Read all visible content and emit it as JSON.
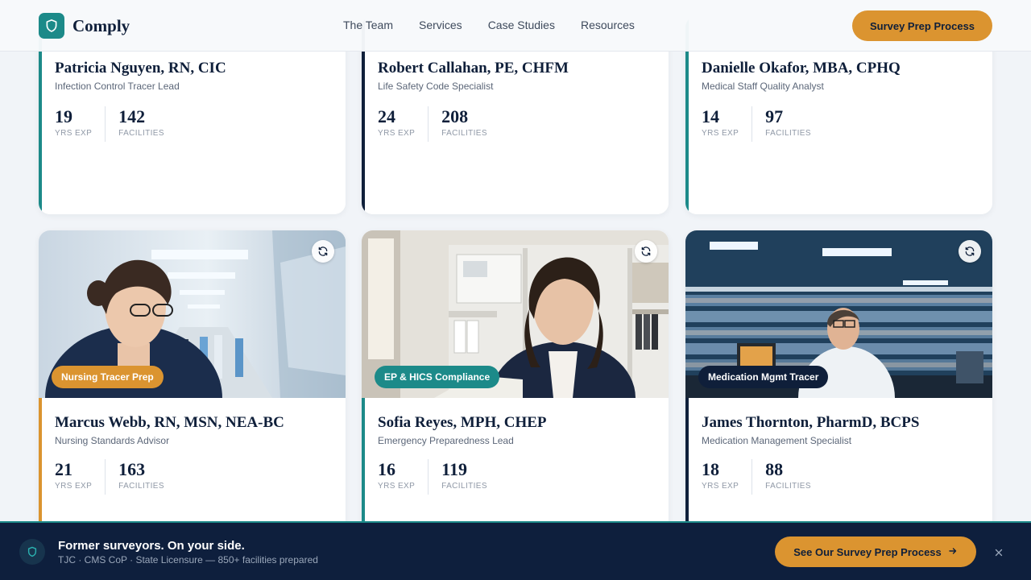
{
  "brand": {
    "name": "Comply",
    "accent": "#1c8a89",
    "navy": "#0f1f3a",
    "gold": "#db9430"
  },
  "nav": {
    "items": [
      {
        "label": "The Team"
      },
      {
        "label": "Services"
      },
      {
        "label": "Case Studies"
      },
      {
        "label": "Resources"
      }
    ],
    "cta_label": "Survey Prep Process"
  },
  "cards": [
    {
      "name": "Patricia Nguyen, RN, CIC",
      "role": "Infection Control Tracer Lead",
      "years": "19",
      "years_label": "YRS EXP",
      "facilities": "142",
      "facilities_label": "FACILITIES",
      "accent_color": "#1c8a89"
    },
    {
      "name": "Robert Callahan, PE, CHFM",
      "role": "Life Safety Code Specialist",
      "years": "24",
      "years_label": "YRS EXP",
      "facilities": "208",
      "facilities_label": "FACILITIES",
      "accent_color": "#0f1f3a"
    },
    {
      "name": "Danielle Okafor, MBA, CPHQ",
      "role": "Medical Staff Quality Analyst",
      "years": "14",
      "years_label": "YRS EXP",
      "facilities": "97",
      "facilities_label": "FACILITIES",
      "accent_color": "#1c8a89"
    },
    {
      "name": "Marcus Webb, RN, MSN, NEA-BC",
      "role": "Nursing Standards Advisor",
      "years": "21",
      "years_label": "YRS EXP",
      "facilities": "163",
      "facilities_label": "FACILITIES",
      "tag": "Nursing Tracer Prep",
      "accent_color": "#db9430"
    },
    {
      "name": "Sofia Reyes, MPH, CHEP",
      "role": "Emergency Preparedness Lead",
      "years": "16",
      "years_label": "YRS EXP",
      "facilities": "119",
      "facilities_label": "FACILITIES",
      "tag": "EP & HICS Compliance",
      "accent_color": "#1c8a89"
    },
    {
      "name": "James Thornton, PharmD, BCPS",
      "role": "Medication Management Specialist",
      "years": "18",
      "years_label": "YRS EXP",
      "facilities": "88",
      "facilities_label": "FACILITIES",
      "tag": "Medication Mgmt Tracer",
      "accent_color": "#0f1f3a"
    }
  ],
  "banner": {
    "title": "Former surveyors. On your side.",
    "subtitle": "TJC · CMS CoP · State Licensure — 850+ facilities prepared",
    "cta_label": "See Our Survey Prep Process",
    "close_icon": "close-icon"
  }
}
